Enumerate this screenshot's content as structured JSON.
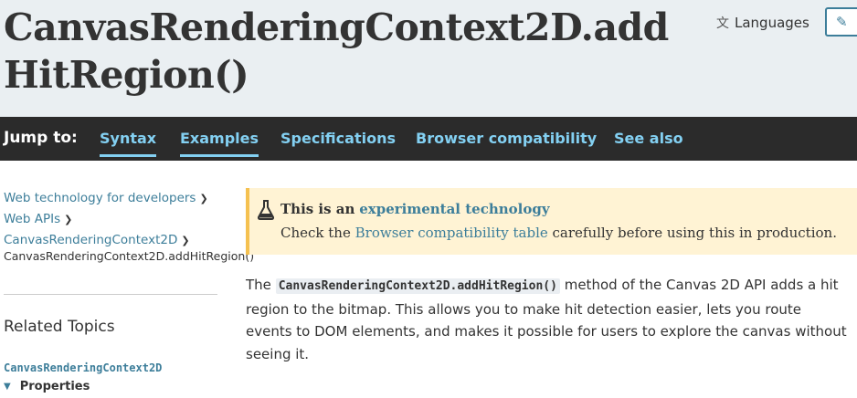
{
  "header": {
    "title_line1": "CanvasRenderingContext2D.add",
    "title_line2": "HitRegion()",
    "languages_label": "Languages",
    "edit_icon": "pencil-icon",
    "languages_icon": "translate-icon"
  },
  "jumpbar": {
    "label": "Jump to:",
    "links": [
      "Syntax",
      "Examples",
      "Specifications",
      "Browser compatibility",
      "See also"
    ]
  },
  "breadcrumbs": {
    "items": [
      "Web technology for developers",
      "Web APIs",
      "CanvasRenderingContext2D"
    ],
    "current": "CanvasRenderingContext2D.addHitRegion()"
  },
  "sidebar": {
    "related_title": "Related Topics",
    "related_interface": "CanvasRenderingContext2D",
    "properties_label": "Properties"
  },
  "notice": {
    "lead": "This is an",
    "link": "experimental technology",
    "line2_before": "Check the",
    "line2_link": "Browser compatibility table",
    "line2_after": "carefully before using this in production.",
    "icon": "flask-icon"
  },
  "summary": {
    "before": "The",
    "code": "CanvasRenderingContext2D.addHitRegion()",
    "after": "method of the Canvas 2D API adds a hit region to the bitmap. This allows you to make hit detection easier, lets you route events to DOM elements, and makes it possible for users to explore the canvas without seeing it."
  },
  "colors": {
    "link": "#3d7e9a",
    "jumpbar_bg": "#2b2b2b",
    "jumpbar_link": "#83d0f2",
    "header_bg": "#eaeff2",
    "notice_bg": "#fff3d4",
    "notice_border": "#f5c150"
  }
}
